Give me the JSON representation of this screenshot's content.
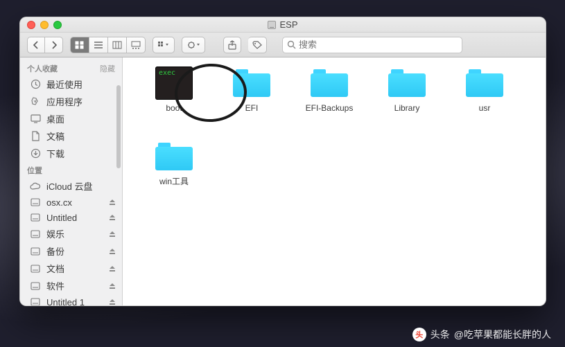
{
  "window": {
    "title": "ESP"
  },
  "search": {
    "placeholder": "搜索"
  },
  "sidebar": {
    "sections": [
      {
        "header": "个人收藏",
        "collapse": "隐藏",
        "items": [
          {
            "icon": "clock",
            "label": "最近使用"
          },
          {
            "icon": "apps",
            "label": "应用程序"
          },
          {
            "icon": "desktop",
            "label": "桌面"
          },
          {
            "icon": "docs",
            "label": "文稿"
          },
          {
            "icon": "download",
            "label": "下载"
          }
        ]
      },
      {
        "header": "位置",
        "collapse": "",
        "items": [
          {
            "icon": "cloud",
            "label": "iCloud 云盘"
          },
          {
            "icon": "disk",
            "label": "osx.cx"
          },
          {
            "icon": "disk",
            "label": "Untitled"
          },
          {
            "icon": "disk",
            "label": "娱乐"
          },
          {
            "icon": "disk",
            "label": "备份"
          },
          {
            "icon": "disk",
            "label": "文档"
          },
          {
            "icon": "disk",
            "label": "软件"
          },
          {
            "icon": "disk",
            "label": "Untitled 1"
          }
        ]
      }
    ]
  },
  "content": {
    "items": [
      {
        "type": "exec",
        "name": "boot",
        "exec_text": "exec"
      },
      {
        "type": "folder",
        "name": "EFI",
        "highlighted": true
      },
      {
        "type": "folder",
        "name": "EFI-Backups"
      },
      {
        "type": "folder",
        "name": "Library"
      },
      {
        "type": "folder",
        "name": "usr"
      },
      {
        "type": "folder",
        "name": "win工具"
      }
    ]
  },
  "watermark": {
    "source": "头条",
    "author": "@吃苹果都能长胖的人"
  }
}
